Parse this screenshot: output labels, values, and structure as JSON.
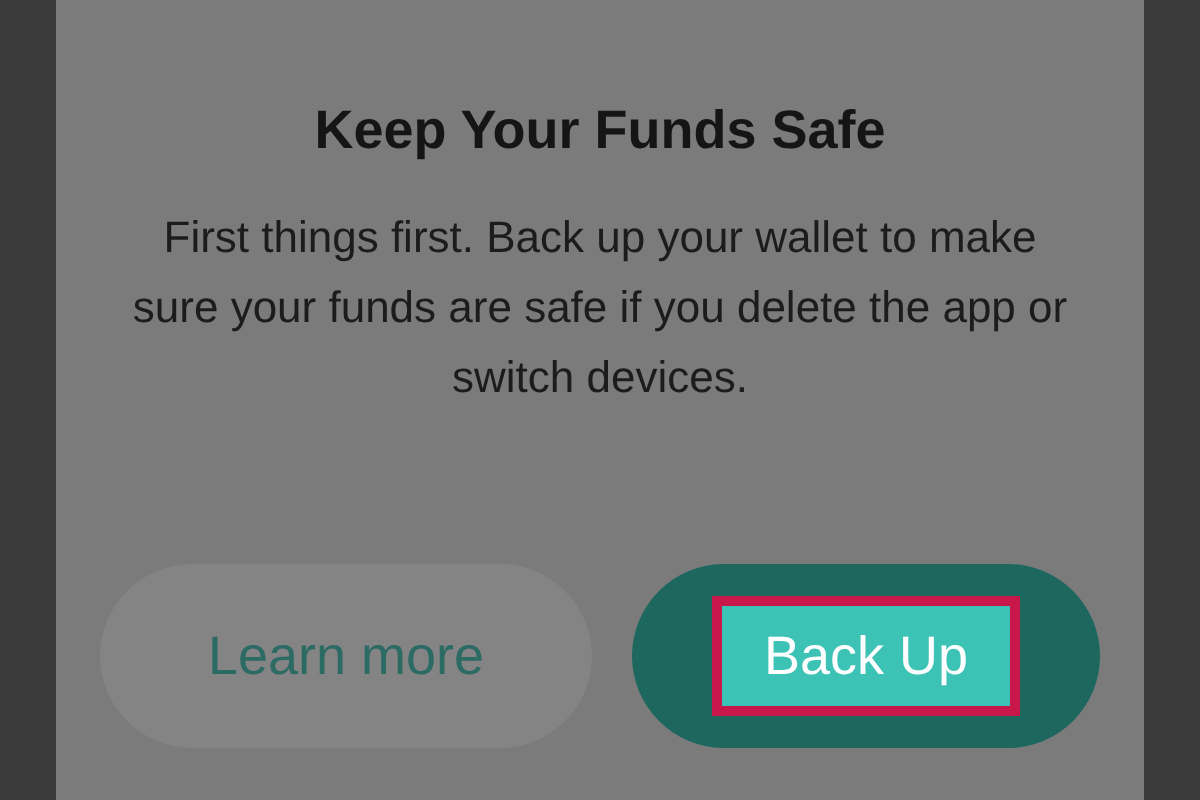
{
  "dialog": {
    "title": "Keep Your Funds Safe",
    "message": "First things first. Back up your wallet to make sure your funds are safe if you delete the app or switch devices."
  },
  "buttons": [
    {
      "label": "Learn more",
      "kind": "secondary",
      "highlighted": false
    },
    {
      "label": "Back Up",
      "kind": "primary",
      "highlighted": true
    }
  ]
}
